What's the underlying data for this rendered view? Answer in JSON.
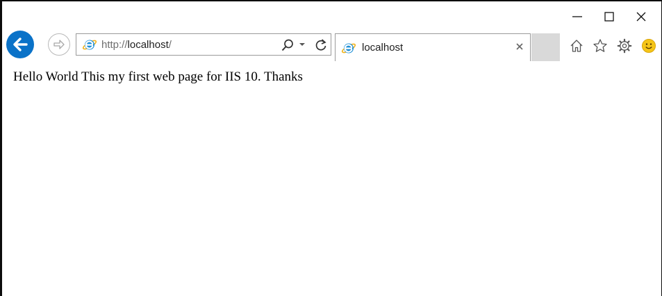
{
  "window": {
    "controls": [
      "minimize",
      "maximize",
      "close"
    ]
  },
  "address_bar": {
    "prefix": "http://",
    "host": "localhost",
    "suffix": "/"
  },
  "tab": {
    "label": "localhost",
    "close_glyph": "×"
  },
  "toolbar_icons": [
    "back-icon",
    "forward-icon",
    "search-icon",
    "dropdown-icon",
    "refresh-icon",
    "home-icon",
    "favorites-star-icon",
    "settings-gear-icon",
    "feedback-smiley-icon"
  ],
  "page": {
    "body_text": "Hello World This my first web page for IIS 10. Thanks"
  },
  "colors": {
    "back_button": "#0a72c8",
    "ie_logo": "#1e8fd6",
    "ie_ring": "#f2b21a",
    "smiley": "#f5c518",
    "new_tab_bg": "#d9d9d9"
  }
}
